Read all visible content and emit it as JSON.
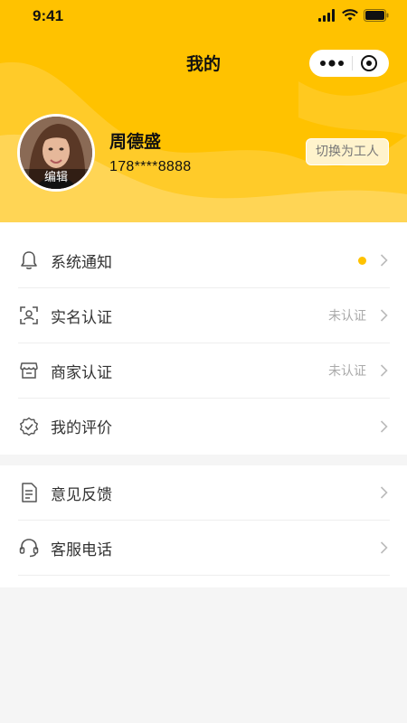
{
  "status_bar": {
    "time": "9:41"
  },
  "nav": {
    "title": "我的"
  },
  "profile": {
    "name": "周德盛",
    "phone": "178****8888",
    "edit_label": "编辑",
    "switch_label": "切换为工人"
  },
  "menu_group_1": [
    {
      "label": "系统通知",
      "status": "",
      "icon": "bell-icon",
      "badge": true
    },
    {
      "label": "实名认证",
      "status": "未认证",
      "icon": "id-scan-icon"
    },
    {
      "label": "商家认证",
      "status": "未认证",
      "icon": "store-icon"
    },
    {
      "label": "我的评价",
      "status": "",
      "icon": "badge-check-icon"
    }
  ],
  "menu_group_2": [
    {
      "label": "意见反馈",
      "status": "",
      "icon": "document-icon"
    },
    {
      "label": "客服电话",
      "status": "",
      "icon": "headset-icon"
    }
  ],
  "colors": {
    "accent": "#ffc200",
    "page_bg": "#f5f5f5"
  }
}
